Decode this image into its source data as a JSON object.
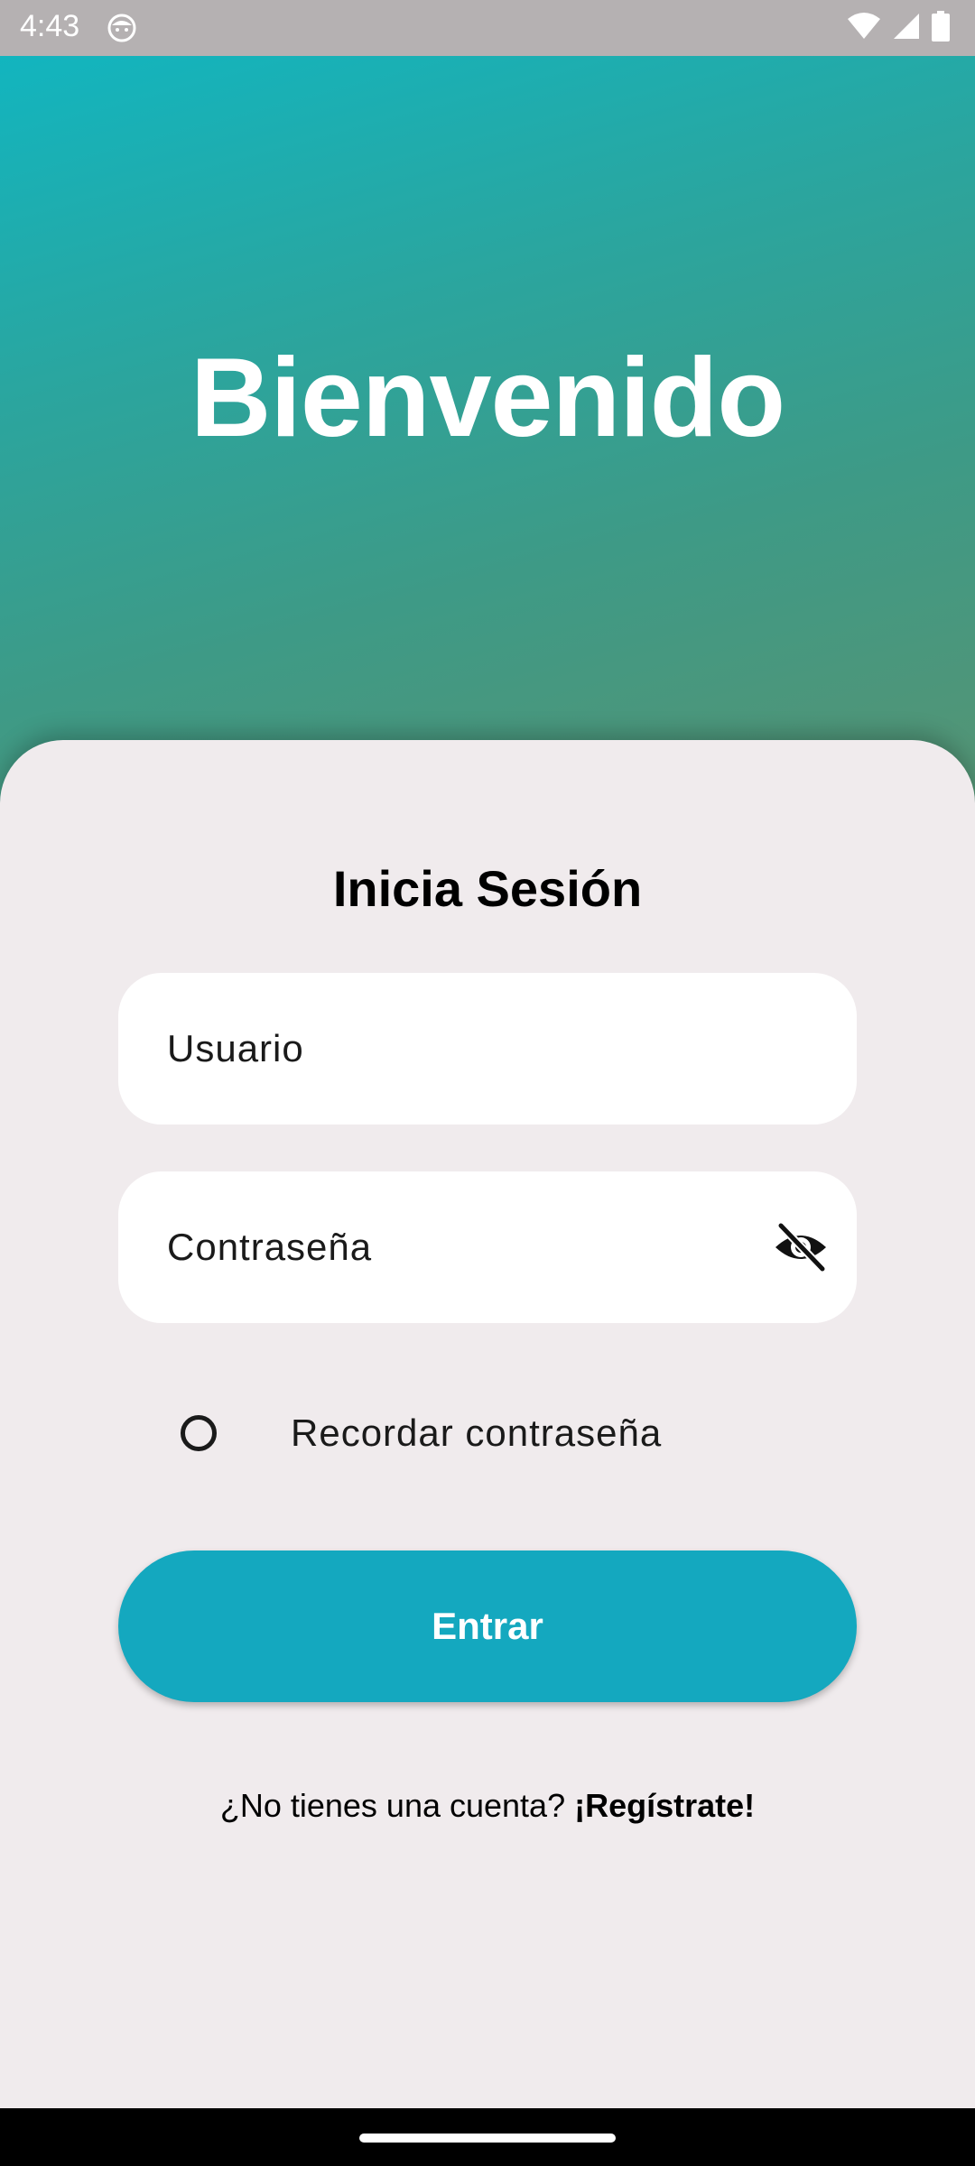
{
  "status_bar": {
    "time": "4:43",
    "app_icon": "face-icon",
    "wifi_icon": "wifi-icon",
    "signal_icon": "signal-icon",
    "battery_icon": "battery-icon"
  },
  "hero": {
    "title": "Bienvenido",
    "gradient_colors": [
      "#12b5bf",
      "#559474"
    ]
  },
  "login": {
    "title": "Inicia Sesión",
    "username_placeholder": "Usuario",
    "password_placeholder": "Contraseña",
    "visibility_icon": "eye-off-icon",
    "remember_label": "Recordar contraseña",
    "remember_checked": false,
    "submit_label": "Entrar",
    "accent_color": "#14a8bf",
    "register_prompt": "¿No tienes una cuenta?",
    "register_link": "¡Regístrate!"
  }
}
